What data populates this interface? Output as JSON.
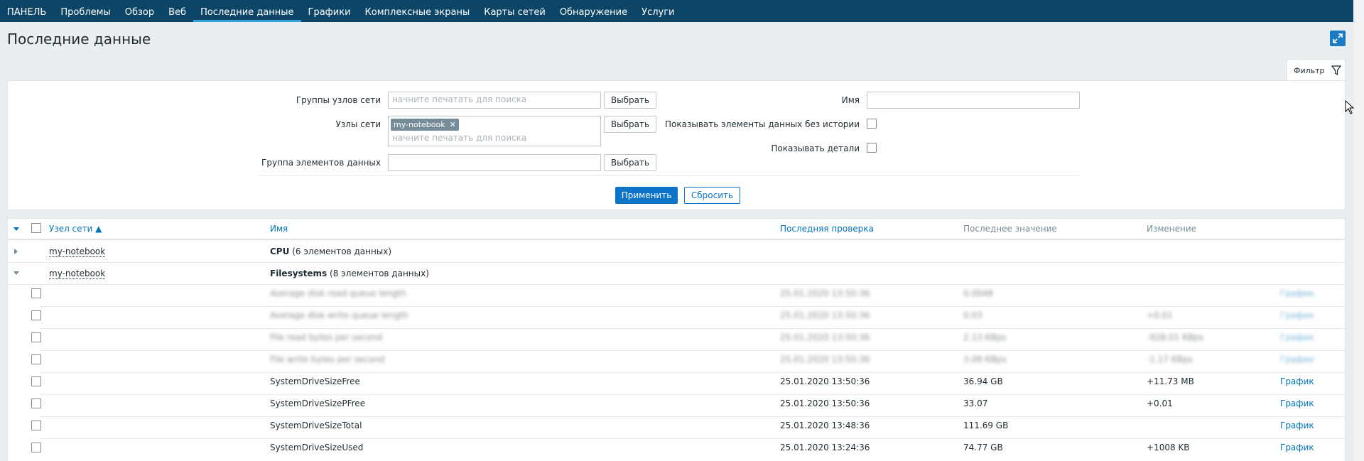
{
  "nav": {
    "items": [
      "ПАНЕЛЬ",
      "Проблемы",
      "Обзор",
      "Веб",
      "Последние данные",
      "Графики",
      "Комплексные экраны",
      "Карты сетей",
      "Обнаружение",
      "Услуги"
    ],
    "active_index": 4
  },
  "page": {
    "title": "Последние данные"
  },
  "filter": {
    "tab_label": "Фильтр",
    "host_groups_label": "Группы узлов сети",
    "host_groups_placeholder": "начните печатать для поиска",
    "hosts_label": "Узлы сети",
    "hosts_selected": "my-notebook",
    "hosts_placeholder": "начните печатать для поиска",
    "app_label": "Группа элементов данных",
    "app_value": "",
    "select_label": "Выбрать",
    "name_label": "Имя",
    "name_value": "",
    "show_without_data_label": "Показывать элементы данных без истории",
    "show_details_label": "Показывать детали",
    "apply_label": "Применить",
    "reset_label": "Сбросить"
  },
  "table": {
    "headers": {
      "host": "Узел сети ▲",
      "name": "Имя",
      "last_check": "Последняя проверка",
      "last_value": "Последнее значение",
      "change": "Изменение"
    },
    "groups": [
      {
        "host": "my-notebook",
        "name": "CPU",
        "count": "(6 элементов данных)",
        "expanded": false
      },
      {
        "host": "my-notebook",
        "name": "Filesystems",
        "count": "(8 элементов данных)",
        "expanded": true
      }
    ],
    "blurred_rows": [
      {
        "name": "Average disk read queue length",
        "time": "25.01.2020 13:50:36",
        "value": "0.0048",
        "change": "",
        "graph": "График"
      },
      {
        "name": "Average disk write queue length",
        "time": "25.01.2020 13:50:36",
        "value": "0.03",
        "change": "+0.01",
        "graph": "График"
      },
      {
        "name": "File read bytes per second",
        "time": "25.01.2020 13:50:36",
        "value": "2.13 KBps",
        "change": "-928.01 KBps",
        "graph": "График"
      },
      {
        "name": "File write bytes per second",
        "time": "25.01.2020 13:50:36",
        "value": "3.08 KBps",
        "change": "-1.17 KBps",
        "graph": "График"
      }
    ],
    "rows": [
      {
        "name": "SystemDriveSizeFree",
        "time": "25.01.2020 13:50:36",
        "value": "36.94 GB",
        "change": "+11.73 MB",
        "graph": "График"
      },
      {
        "name": "SystemDriveSizePFree",
        "time": "25.01.2020 13:50:36",
        "value": "33.07",
        "change": "+0.01",
        "graph": "График"
      },
      {
        "name": "SystemDriveSizeTotal",
        "time": "25.01.2020 13:48:36",
        "value": "111.69 GB",
        "change": "",
        "graph": "График"
      },
      {
        "name": "SystemDriveSizeUsed",
        "time": "25.01.2020 13:24:36",
        "value": "74.77 GB",
        "change": "+1008 KB",
        "graph": "График"
      }
    ]
  },
  "colors": {
    "nav_bg": "#0c4566",
    "accent": "#0c75c9",
    "link": "#0275b8"
  },
  "icons": [
    "fullscreen-icon",
    "filter-icon",
    "remove-icon",
    "expand-icon",
    "collapse-icon",
    "mouse-cursor-icon"
  ]
}
